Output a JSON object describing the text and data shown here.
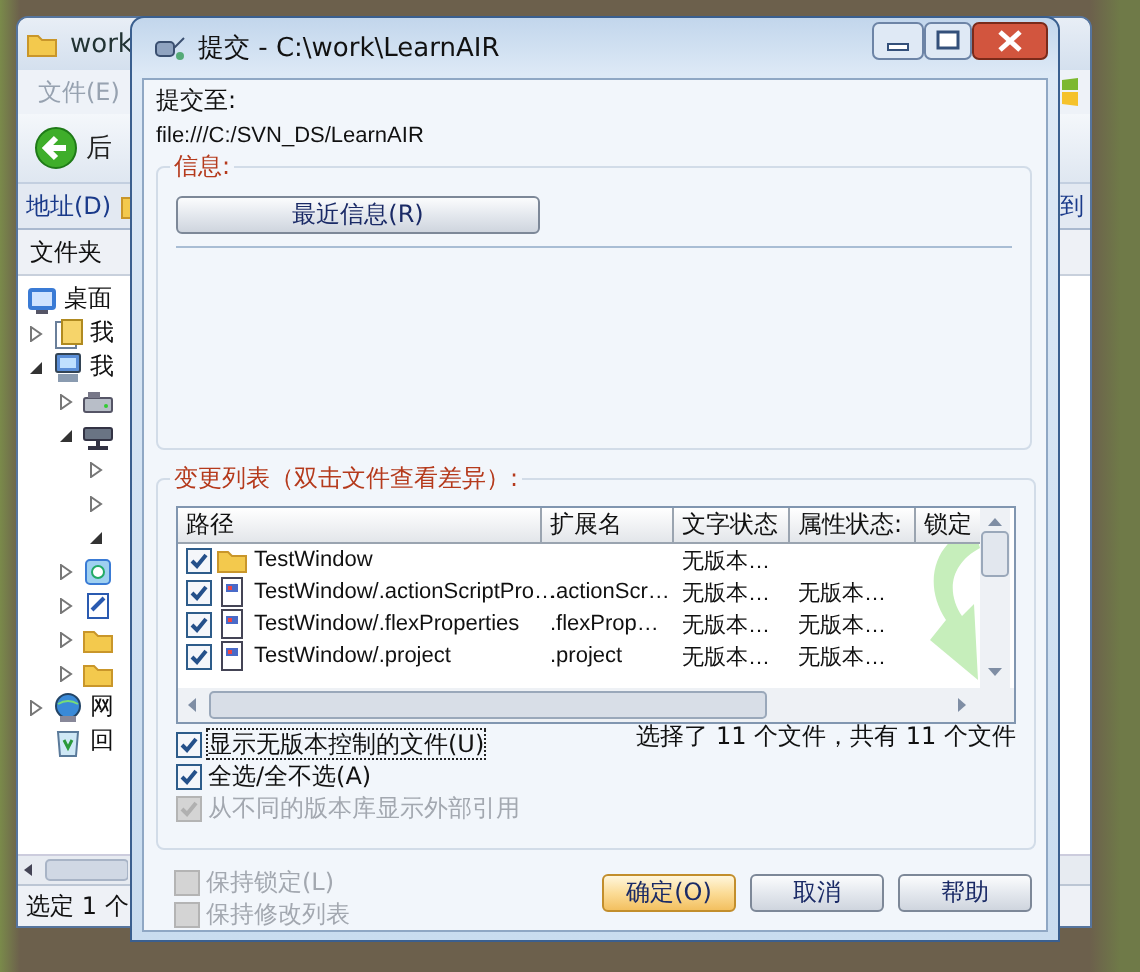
{
  "explorer": {
    "title": "work",
    "menu": [
      "文件(E)"
    ],
    "back_button": "后",
    "address_label": "地址(D)",
    "go_button": "到",
    "folders_header": "文件夹",
    "tree": [
      {
        "kind": "desktop",
        "label": "桌面",
        "children": [
          {
            "kind": "documents",
            "label": "我",
            "expanded": false
          },
          {
            "kind": "computer",
            "label": "我",
            "expanded": true,
            "children": [
              {
                "kind": "drive",
                "expanded": false
              },
              {
                "kind": "netdrive",
                "expanded": true,
                "children": [
                  {
                    "expanded": false
                  },
                  {
                    "expanded": false
                  },
                  {
                    "expanded": true
                  }
                ]
              },
              {
                "kind": "control",
                "expanded": false
              },
              {
                "kind": "device",
                "expanded": false
              },
              {
                "kind": "folder",
                "expanded": false
              },
              {
                "kind": "folder",
                "expanded": false
              }
            ]
          },
          {
            "kind": "network",
            "label": "网",
            "expanded": false
          },
          {
            "kind": "recycle",
            "label": "回"
          }
        ]
      }
    ],
    "status_bar": "选定 1 个"
  },
  "dialog": {
    "title": "提交 - C:\\work\\LearnAIR",
    "commit_to_label": "提交至:",
    "url": "file:///C:/SVN_DS/LearnAIR",
    "message_group": {
      "title": "信息:",
      "recent_button": "最近信息(R)"
    },
    "changes_group": {
      "title": "变更列表（双击文件查看差异）:",
      "columns": [
        "路径",
        "扩展名",
        "文字状态",
        "属性状态:",
        "锁定"
      ],
      "rows": [
        {
          "kind": "folder",
          "checked": true,
          "path": "TestWindow",
          "text_status": "无版本…"
        },
        {
          "kind": "file",
          "checked": true,
          "path": "TestWindow/.actionScriptPro…",
          "extension": ".actionScr…",
          "text_status": "无版本…",
          "property_status": "无版本…"
        },
        {
          "kind": "file",
          "checked": true,
          "path": "TestWindow/.flexProperties",
          "extension": ".flexProp…",
          "text_status": "无版本…",
          "property_status": "无版本…"
        },
        {
          "kind": "file",
          "checked": true,
          "path": "TestWindow/.project",
          "extension": ".project",
          "text_status": "无版本…",
          "property_status": "无版本…"
        }
      ],
      "summary": "选择了 11 个文件，共有 11 个文件",
      "options": [
        {
          "label": "显示无版本控制的文件(U)",
          "checked": true,
          "disabled": false,
          "focused": true
        },
        {
          "label": "全选/全不选(A)",
          "checked": true,
          "disabled": false,
          "focused": false
        },
        {
          "label": "从不同的版本库显示外部引用",
          "checked": true,
          "disabled": true,
          "focused": false
        }
      ]
    },
    "bottom_options": [
      {
        "label": "保持锁定(L)",
        "checked": false,
        "disabled": true
      },
      {
        "label": "保持修改列表",
        "checked": false,
        "disabled": true
      }
    ],
    "buttons": [
      {
        "label": "确定(O)",
        "default": true
      },
      {
        "label": "取消",
        "default": false
      },
      {
        "label": "帮助",
        "default": false
      }
    ]
  }
}
